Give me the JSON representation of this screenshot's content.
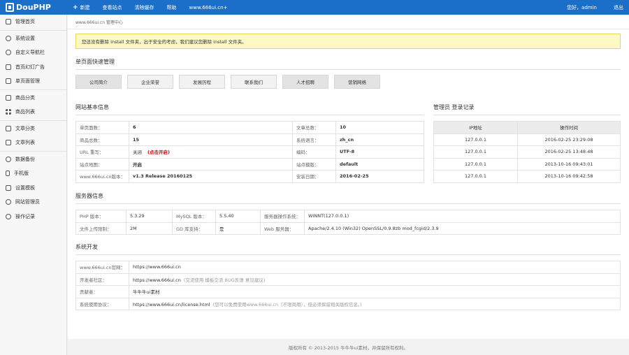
{
  "header": {
    "logo_text": "DouPHP",
    "nav": [
      {
        "label": "新建",
        "icon": "plus-icon"
      },
      {
        "label": "查看站点"
      },
      {
        "label": "清除缓存"
      },
      {
        "label": "帮助"
      },
      {
        "label": "www.666ui.cn+"
      }
    ],
    "greeting": "您好，admin",
    "logout": "退出"
  },
  "sidebar": {
    "items": [
      {
        "label": "管理首页",
        "icon": "home-icon"
      },
      {
        "label": "系统设置",
        "icon": "gear-icon"
      },
      {
        "label": "自定义导航栏",
        "icon": "navigation-icon"
      },
      {
        "label": "首页幻灯广告",
        "icon": "slideshow-icon"
      },
      {
        "label": "单页面管理",
        "icon": "page-icon"
      },
      {
        "label": "商品分类",
        "icon": "category-icon"
      },
      {
        "label": "商品列表",
        "icon": "grid-icon"
      },
      {
        "label": "文章分类",
        "icon": "folder-icon"
      },
      {
        "label": "文章列表",
        "icon": "document-icon"
      },
      {
        "label": "数据备份",
        "icon": "database-icon"
      },
      {
        "label": "手机版",
        "icon": "mobile-icon"
      },
      {
        "label": "设置模板",
        "icon": "template-icon"
      },
      {
        "label": "网站管理员",
        "icon": "user-icon"
      },
      {
        "label": "操作记录",
        "icon": "history-icon"
      }
    ]
  },
  "breadcrumb": "www.666ui.cn 管理中心",
  "notice": "您还没有删除 install 文件夹，出于安全的考虑，我们建议您删除 install 文件夹。",
  "quick": {
    "title": "单页面快速管理",
    "buttons": [
      "公司简介",
      "企业荣誉",
      "发展历程",
      "联系我们",
      "人才招聘",
      "营销网络"
    ]
  },
  "site_info": {
    "title": "网站基本信息",
    "rows": [
      [
        "单页面数：",
        "6",
        "文章总数：",
        "10"
      ],
      [
        "商品总数：",
        "15",
        "系统语言：",
        "zh_cn"
      ],
      [
        "URL 重写：",
        "关闭",
        "编码：",
        "UTF-8"
      ],
      [
        "站点地图：",
        "开启",
        "站点模版：",
        "default"
      ],
      [
        "www.666ui.cn版本：",
        "v1.3 Release 20160125",
        "安装日期：",
        "2016-02-25"
      ]
    ],
    "url_rewrite_action": "(点击开启)"
  },
  "login_log": {
    "title": "管理员 登录记录",
    "headers": [
      "IP地址",
      "操作时间"
    ],
    "rows": [
      [
        "127.0.0.1",
        "2016-02-25 23:29:08"
      ],
      [
        "127.0.0.1",
        "2016-02-25 13:48:48"
      ],
      [
        "127.0.0.1",
        "2013-10-16 09:43:01"
      ],
      [
        "127.0.0.1",
        "2013-10-16 09:42:58"
      ]
    ]
  },
  "server_info": {
    "title": "服务器信息",
    "rows": [
      [
        "PHP 版本：",
        "5.3.29",
        "MySQL 版本：",
        "5.5.40",
        "服务器操作系统：",
        "WINNT(127.0.0.1)"
      ],
      [
        "文件上传限制：",
        "2M",
        "GD 库支持：",
        "是",
        "Web 服务器：",
        "Apache/2.4.10 (Win32) OpenSSL/0.9.8zb mod_fcgid/2.3.9"
      ]
    ]
  },
  "dev": {
    "title": "系统开发",
    "rows": [
      {
        "label": "www.666ui.cn官网：",
        "value": "https://www.666ui.cn",
        "note": ""
      },
      {
        "label": "开发者社区：",
        "value": "https://www.666ui.cn",
        "note": "(交流使用 模板交流 BUG反馈 意见建议)"
      },
      {
        "label": "贡献者：",
        "value": "牛牛牛ui素材",
        "note": ""
      },
      {
        "label": "系统使用协议：",
        "value": "https://www.666ui.cn/license.html",
        "note": "(您可以免费使用www.666ui.cn（不限商用），但必须保留相关版权信息。)"
      }
    ]
  },
  "footer": "版权所有 © 2013-2015 牛牛牛ui素材，并保留所有权利。"
}
